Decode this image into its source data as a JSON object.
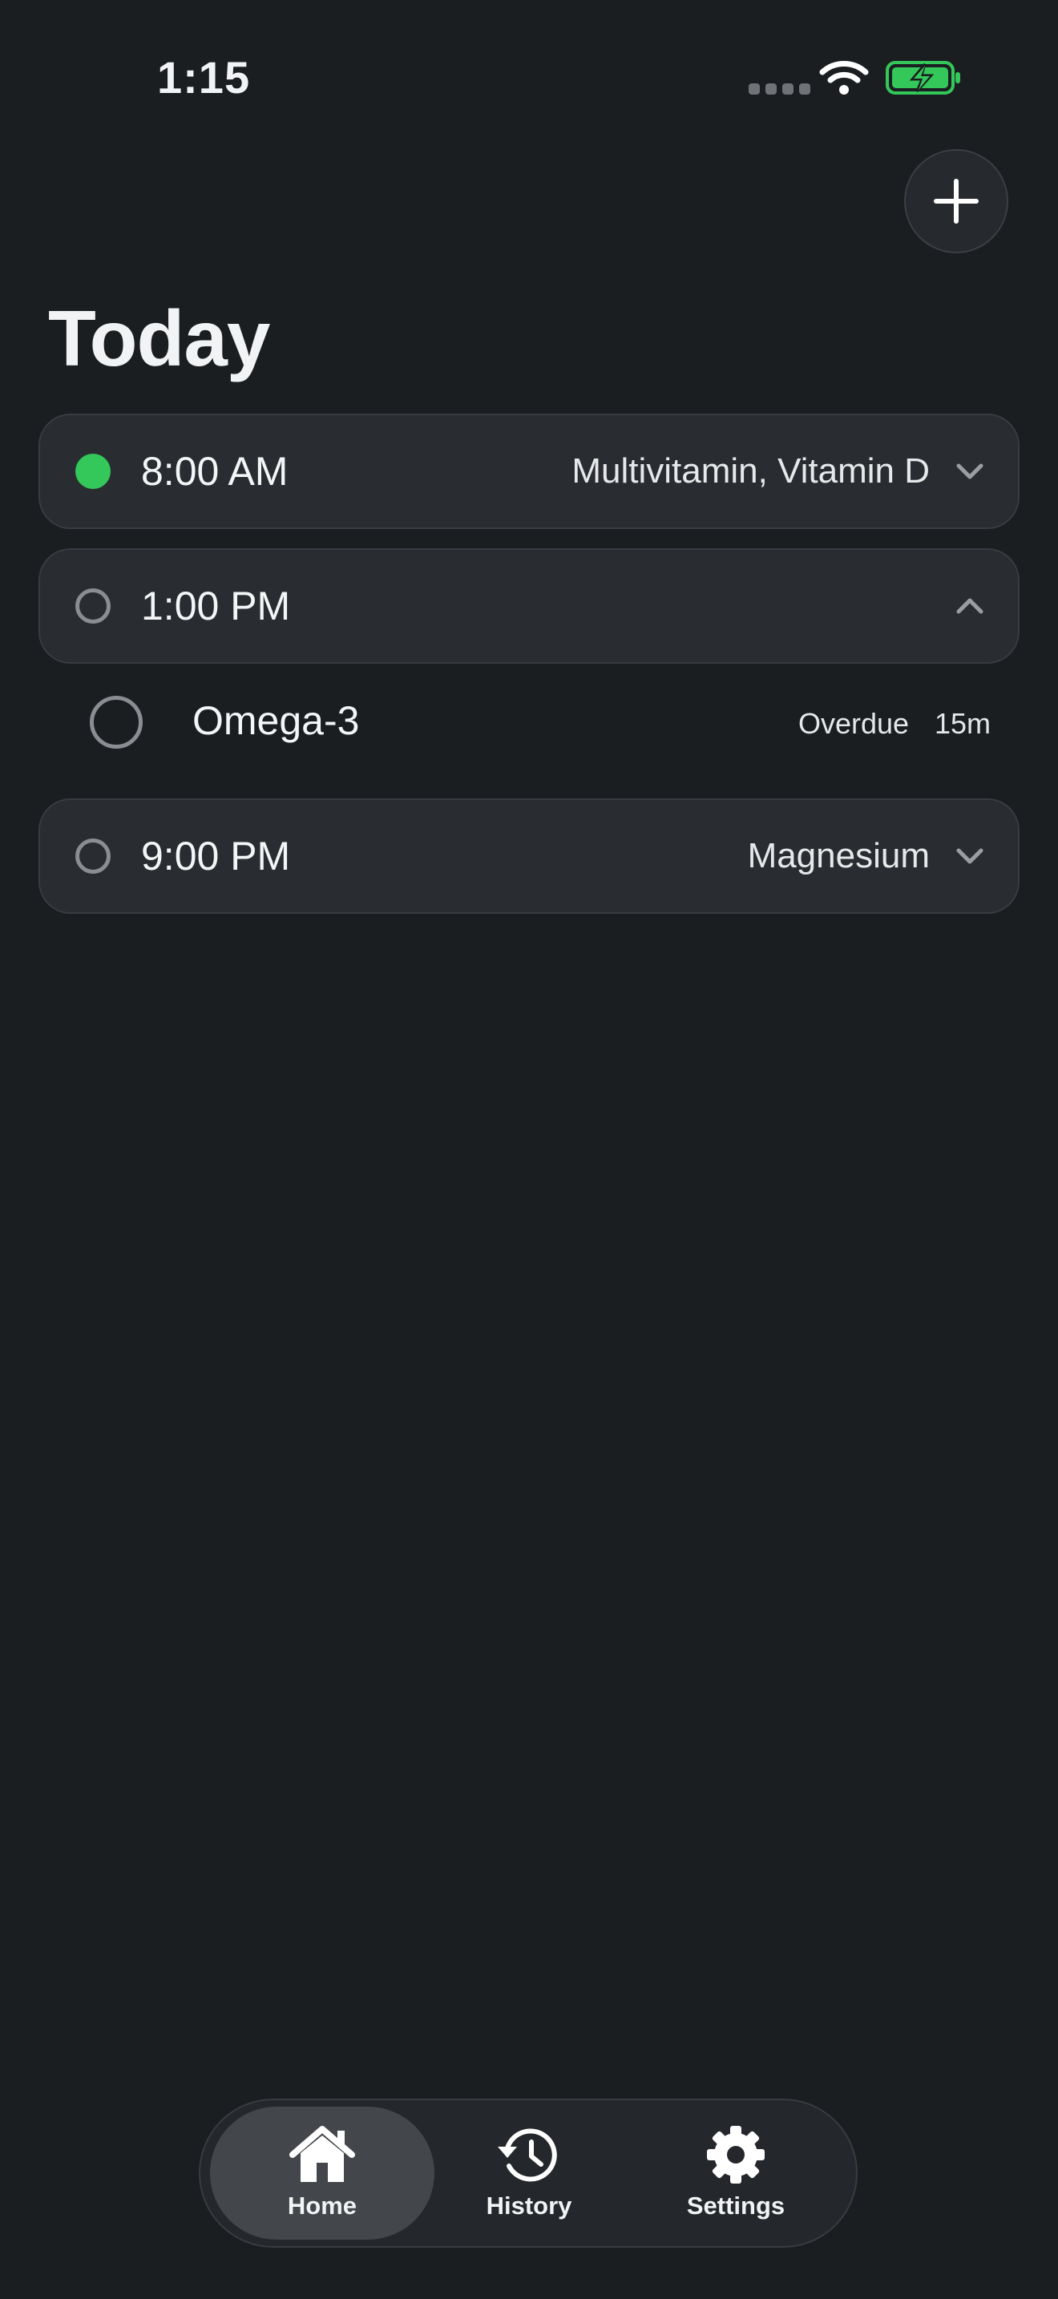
{
  "status_bar": {
    "time": "1:15",
    "battery_state": "charging"
  },
  "header": {
    "add_icon": "plus-icon",
    "title": "Today"
  },
  "doses": [
    {
      "time": "8:00 AM",
      "summary": "Multivitamin, Vitamin D",
      "taken": true,
      "expanded": false
    },
    {
      "time": "1:00 PM",
      "summary": "",
      "taken": false,
      "expanded": true,
      "items": [
        {
          "name": "Omega-3",
          "status": "Overdue",
          "overdue_by": "15m"
        }
      ]
    },
    {
      "time": "9:00 PM",
      "summary": "Magnesium",
      "taken": false,
      "expanded": false
    }
  ],
  "tab_bar": {
    "tabs": [
      {
        "label": "Home",
        "icon": "home-icon",
        "active": true
      },
      {
        "label": "History",
        "icon": "history-icon",
        "active": false
      },
      {
        "label": "Settings",
        "icon": "gear-icon",
        "active": false
      }
    ]
  },
  "colors": {
    "background": "#1b1e21",
    "card": "#292d31",
    "taken": "#34c759",
    "battery": "#34c759"
  }
}
